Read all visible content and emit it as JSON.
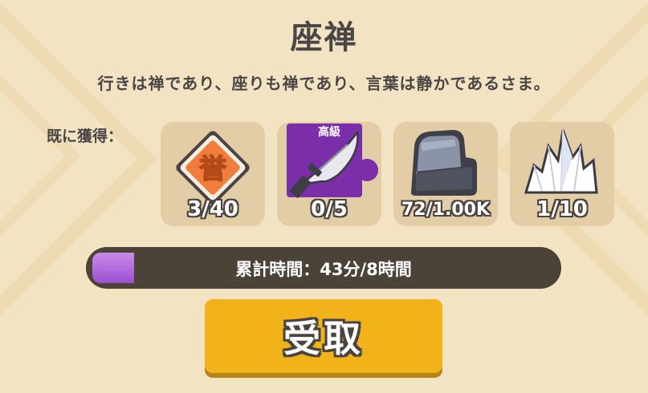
{
  "title": "座禅",
  "description": "行きは禅であり、座りも禅であり、言葉は静かであるさま。",
  "obtained_label": "既に獲得：",
  "rewards": [
    {
      "icon": "honor-token-icon",
      "icon_char": "誉",
      "count": "3/40"
    },
    {
      "icon": "blade-icon",
      "badge": "高級",
      "count": "0/5"
    },
    {
      "icon": "stone-icon",
      "count": "72/1.00K"
    },
    {
      "icon": "crystal-icon",
      "count": "1/10"
    }
  ],
  "progress": {
    "label": "累計時間：43分/8時間",
    "fraction": 0.09
  },
  "claim_button": {
    "label": "受取"
  },
  "colors": {
    "accent_gold": "#f2b21a",
    "progress_purple": "#a85ad8",
    "text_dark": "#4b4646",
    "panel_bg": "#f2e3c2"
  }
}
